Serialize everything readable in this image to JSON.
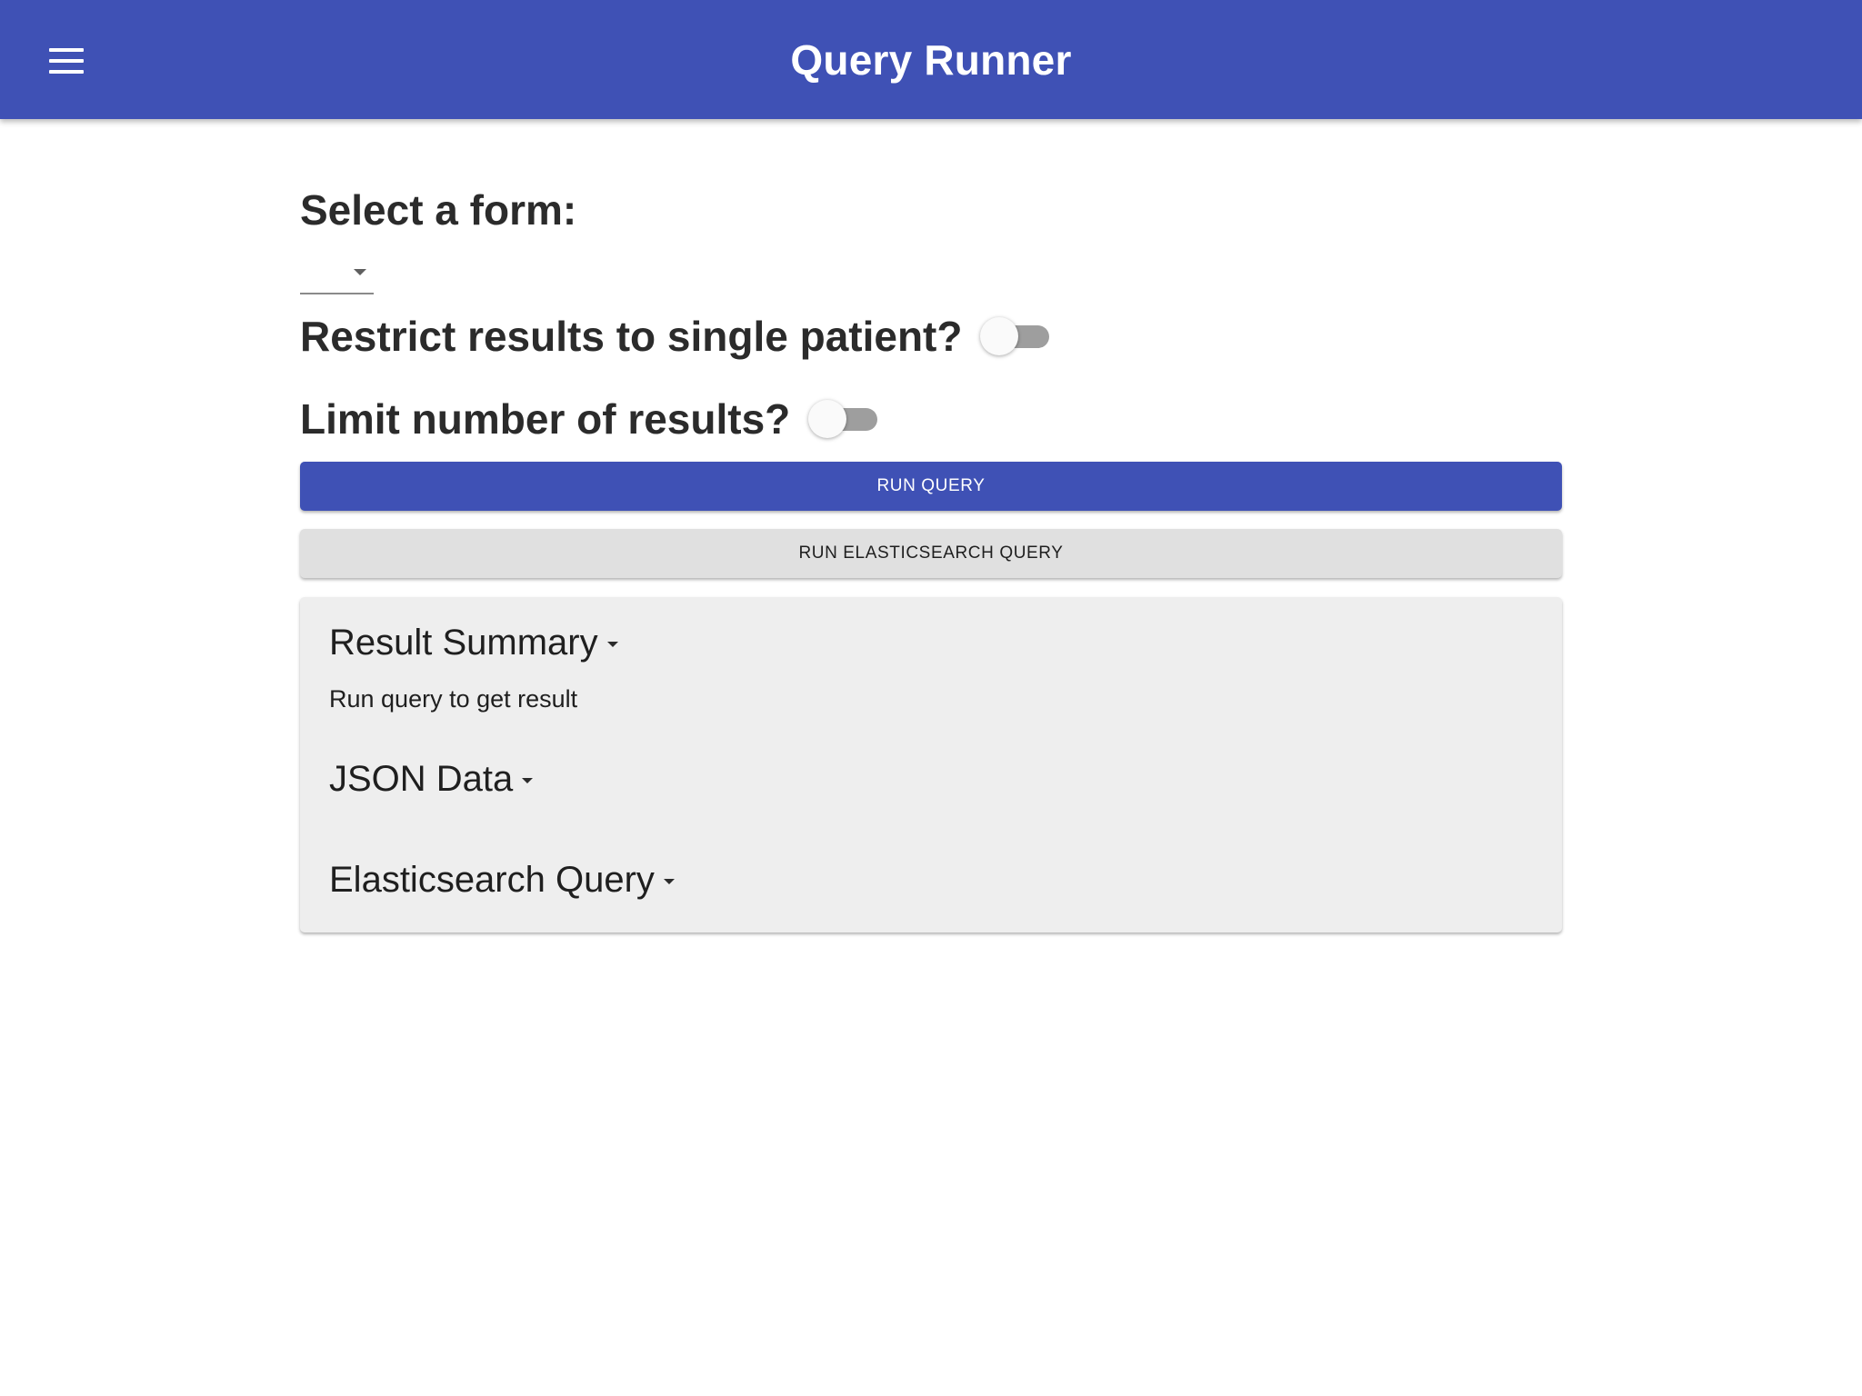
{
  "appbar": {
    "title": "Query Runner",
    "menu_icon": "hamburger-menu-icon",
    "color": "#3f51b5"
  },
  "form_select": {
    "heading": "Select a form:",
    "selected_value": ""
  },
  "toggles": {
    "single_patient": {
      "label": "Restrict results to single patient?",
      "checked": false
    },
    "limit_results": {
      "label": "Limit number of results?",
      "checked": false
    }
  },
  "buttons": {
    "run_query": "RUN QUERY",
    "run_elasticsearch_query": "RUN ELASTICSEARCH QUERY"
  },
  "results": {
    "summary": {
      "title": "Result Summary",
      "text": "Run query to get result"
    },
    "json_data": {
      "title": "JSON Data"
    },
    "elasticsearch_query": {
      "title": "Elasticsearch Query"
    }
  },
  "colors": {
    "primary": "#3f51b5",
    "secondary_button": "#e0e0e0",
    "panel": "#eeeeee",
    "switch_track": "#9e9e9e"
  }
}
